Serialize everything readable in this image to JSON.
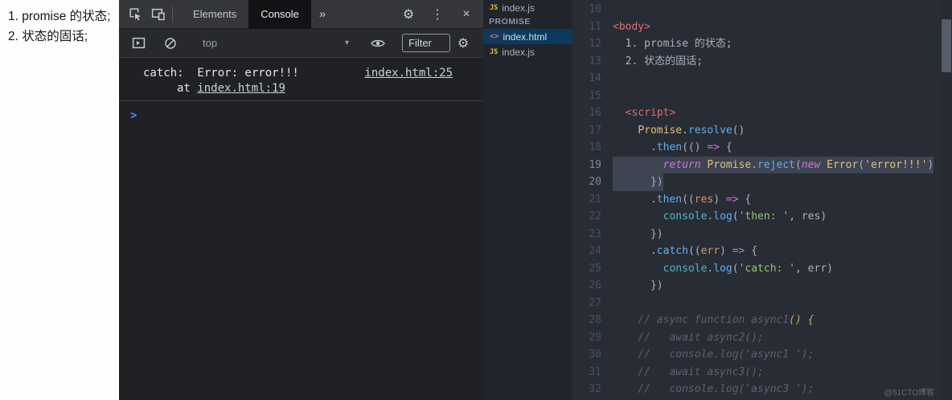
{
  "note": {
    "text": "1. promise 的状态; 2. 状态的固话;"
  },
  "colors": {
    "devtools_bg": "#202124",
    "editor_bg": "#282c34",
    "selection": "#3e4451",
    "sidebar_selected": "#0b3a5e",
    "prompt_blue": "#4f8ef7",
    "tag_red": "#e06c75",
    "class_yellow": "#e5c07b",
    "method_blue": "#61afef"
  },
  "icons": {
    "gear": "⚙",
    "kebab": "⋮",
    "close": "×",
    "more_tabs": "»",
    "caret": "▾",
    "prompt": ">"
  },
  "devtools": {
    "tabs": [
      {
        "label": "Elements",
        "active": false
      },
      {
        "label": "Console",
        "active": true
      }
    ],
    "context": "top",
    "filter": {
      "placeholder": "Filter",
      "value": ""
    },
    "log": {
      "line1": "catch:  Error: error!!!",
      "line1_link": "index.html:25",
      "line2_prefix": "at ",
      "line2_link": "index.html:19"
    }
  },
  "explorer": {
    "open_file": "index.js",
    "folder_label": "PROMISE",
    "files": [
      {
        "name": "index.html",
        "type": "html",
        "selected": true
      },
      {
        "name": "index.js",
        "type": "js",
        "selected": false
      }
    ]
  },
  "editor": {
    "lines": [
      {
        "n": 10,
        "t": []
      },
      {
        "n": 11,
        "t": [
          [
            "tag",
            "<body>"
          ]
        ]
      },
      {
        "n": 12,
        "t": [
          [
            "fg",
            "  1. promise 的状态;"
          ]
        ]
      },
      {
        "n": 13,
        "t": [
          [
            "fg",
            "  2. 状态的固话;"
          ]
        ]
      },
      {
        "n": 14,
        "t": []
      },
      {
        "n": 15,
        "t": []
      },
      {
        "n": 16,
        "t": [
          [
            "fg",
            "  "
          ],
          [
            "tag",
            "<script>"
          ]
        ]
      },
      {
        "n": 17,
        "t": [
          [
            "fg",
            "    "
          ],
          [
            "cls",
            "Promise"
          ],
          [
            "punc",
            "."
          ],
          [
            "fn",
            "resolve"
          ],
          [
            "punc",
            "()"
          ]
        ]
      },
      {
        "n": 18,
        "t": [
          [
            "fg",
            "      "
          ],
          [
            "punc",
            "."
          ],
          [
            "fn",
            "then"
          ],
          [
            "punc",
            "(() "
          ],
          [
            "kw",
            "=>"
          ],
          [
            "punc",
            " {"
          ]
        ]
      },
      {
        "n": 19,
        "sel": true,
        "t": [
          [
            "fg",
            "        "
          ],
          [
            "kw",
            "return"
          ],
          [
            "fg",
            " "
          ],
          [
            "cls",
            "Promise"
          ],
          [
            "punc",
            "."
          ],
          [
            "fn",
            "reject"
          ],
          [
            "punc",
            "("
          ],
          [
            "kw",
            "new"
          ],
          [
            "fg",
            " "
          ],
          [
            "cls",
            "Error"
          ],
          [
            "punc",
            "("
          ],
          [
            "strv",
            "'error!!!'"
          ],
          [
            "punc",
            ")"
          ]
        ]
      },
      {
        "n": 20,
        "sel": true,
        "t": [
          [
            "fg",
            "      "
          ],
          [
            "punc",
            "})"
          ]
        ]
      },
      {
        "n": 21,
        "t": [
          [
            "fg",
            "      "
          ],
          [
            "punc",
            "."
          ],
          [
            "fn",
            "then"
          ],
          [
            "punc",
            "(("
          ],
          [
            "orange",
            "res"
          ],
          [
            "punc",
            ") "
          ],
          [
            "kw",
            "=>"
          ],
          [
            "punc",
            " {"
          ]
        ]
      },
      {
        "n": 22,
        "t": [
          [
            "fg",
            "        "
          ],
          [
            "cyan",
            "console"
          ],
          [
            "punc",
            "."
          ],
          [
            "fn",
            "log"
          ],
          [
            "punc",
            "("
          ],
          [
            "str",
            "'then: '"
          ],
          [
            "punc",
            ", "
          ],
          [
            "fg",
            "res"
          ],
          [
            "punc",
            ")"
          ]
        ]
      },
      {
        "n": 23,
        "t": [
          [
            "fg",
            "      "
          ],
          [
            "punc",
            "})"
          ]
        ]
      },
      {
        "n": 24,
        "t": [
          [
            "fg",
            "      "
          ],
          [
            "punc",
            "."
          ],
          [
            "fn",
            "catch"
          ],
          [
            "punc",
            "(("
          ],
          [
            "orange",
            "err"
          ],
          [
            "punc",
            ") "
          ],
          [
            "kw",
            "=>"
          ],
          [
            "punc",
            " {"
          ]
        ]
      },
      {
        "n": 25,
        "t": [
          [
            "fg",
            "        "
          ],
          [
            "cyan",
            "console"
          ],
          [
            "punc",
            "."
          ],
          [
            "fn",
            "log"
          ],
          [
            "punc",
            "("
          ],
          [
            "str",
            "'catch: '"
          ],
          [
            "punc",
            ", "
          ],
          [
            "fg",
            "err"
          ],
          [
            "punc",
            ")"
          ]
        ]
      },
      {
        "n": 26,
        "t": [
          [
            "fg",
            "      "
          ],
          [
            "punc",
            "})"
          ]
        ]
      },
      {
        "n": 27,
        "t": []
      },
      {
        "n": 28,
        "t": [
          [
            "cmt",
            "    // async function async1"
          ],
          [
            "cmtg",
            "() {"
          ]
        ]
      },
      {
        "n": 29,
        "t": [
          [
            "cmt",
            "    //   await async2();"
          ]
        ]
      },
      {
        "n": 30,
        "t": [
          [
            "cmt",
            "    //   console.log('async1 ');"
          ]
        ]
      },
      {
        "n": 31,
        "t": [
          [
            "cmt",
            "    //   await async3();"
          ]
        ]
      },
      {
        "n": 32,
        "t": [
          [
            "cmt",
            "    //   console.log('async3 ');"
          ]
        ]
      }
    ]
  },
  "watermark": "@51CTO博客"
}
